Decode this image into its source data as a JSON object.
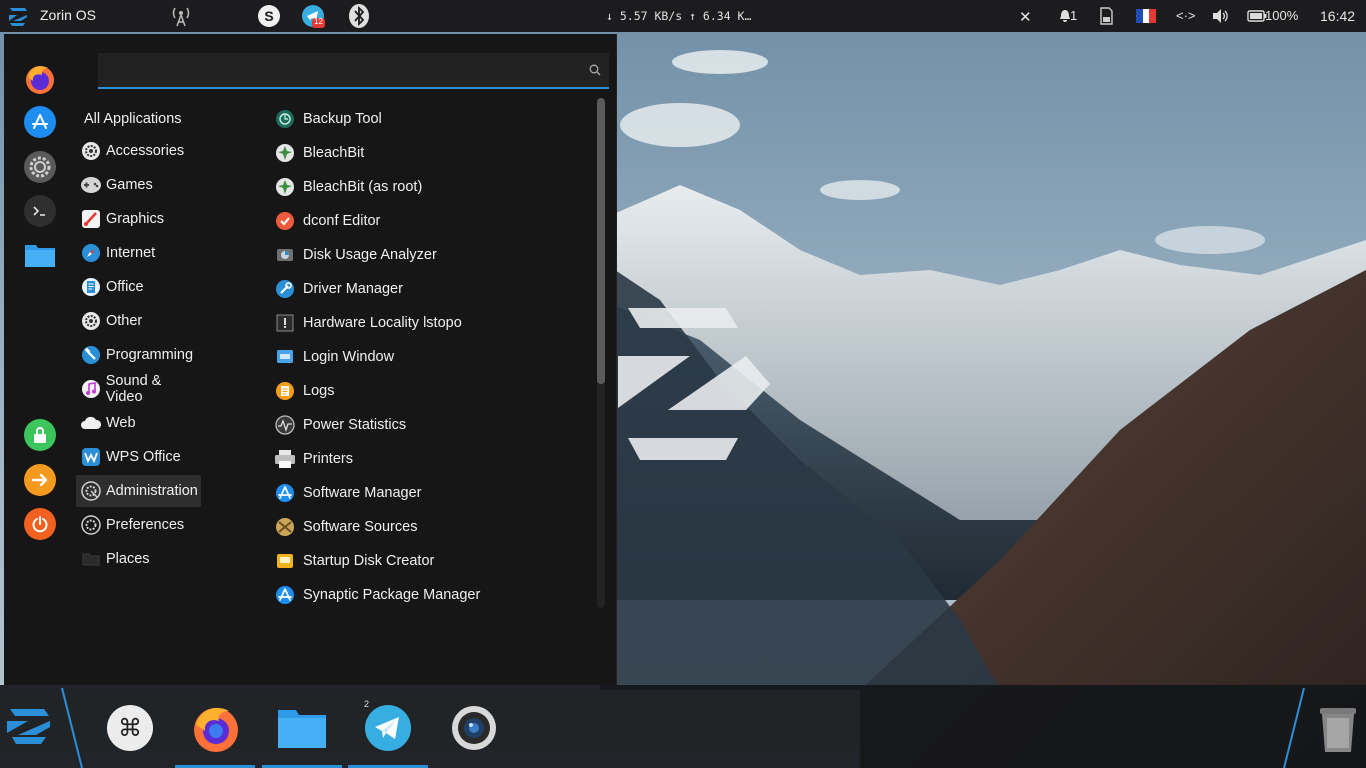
{
  "top_panel": {
    "title": "Zorin OS",
    "network_speed": "↓ 5.57 KB/s ↑ 6.34 K…",
    "notification_count": "1",
    "battery": "100%",
    "clock": "16:42",
    "telegram_badge": "12"
  },
  "search": {
    "placeholder": "",
    "value": ""
  },
  "categories": [
    {
      "label": "All Applications",
      "icon": "none"
    },
    {
      "label": "Accessories",
      "icon": "gear-icon"
    },
    {
      "label": "Games",
      "icon": "gamepad-icon"
    },
    {
      "label": "Graphics",
      "icon": "brush-icon"
    },
    {
      "label": "Internet",
      "icon": "compass-icon"
    },
    {
      "label": "Office",
      "icon": "document-icon"
    },
    {
      "label": "Other",
      "icon": "gear-icon"
    },
    {
      "label": "Programming",
      "icon": "hammer-icon"
    },
    {
      "label": "Sound & Video",
      "icon": "music-icon"
    },
    {
      "label": "Web",
      "icon": "cloud-icon"
    },
    {
      "label": "WPS Office",
      "icon": "wps-icon"
    },
    {
      "label": "Administration",
      "icon": "admin-icon"
    },
    {
      "label": "Preferences",
      "icon": "preferences-icon"
    },
    {
      "label": "Places",
      "icon": "folder-icon"
    }
  ],
  "selected_category": "Administration",
  "applications": [
    {
      "label": "Backup Tool",
      "icon": "backup-icon"
    },
    {
      "label": "BleachBit",
      "icon": "bleachbit-icon"
    },
    {
      "label": "BleachBit (as root)",
      "icon": "bleachbit-icon"
    },
    {
      "label": "dconf Editor",
      "icon": "dconf-icon"
    },
    {
      "label": "Disk Usage Analyzer",
      "icon": "disk-usage-icon"
    },
    {
      "label": "Driver Manager",
      "icon": "driver-icon"
    },
    {
      "label": "Hardware Locality lstopo",
      "icon": "hwloc-icon"
    },
    {
      "label": "Login Window",
      "icon": "login-icon"
    },
    {
      "label": "Logs",
      "icon": "logs-icon"
    },
    {
      "label": "Power Statistics",
      "icon": "power-stats-icon"
    },
    {
      "label": "Printers",
      "icon": "printer-icon"
    },
    {
      "label": "Software Manager",
      "icon": "software-manager-icon"
    },
    {
      "label": "Software Sources",
      "icon": "software-sources-icon"
    },
    {
      "label": "Startup Disk Creator",
      "icon": "startup-disk-icon"
    },
    {
      "label": "Synaptic Package Manager",
      "icon": "synaptic-icon"
    }
  ],
  "dock": {
    "telegram_badge": "2"
  },
  "colors": {
    "accent": "#2b8fd8",
    "menu_bg": "#161616",
    "panel_bg": "#1c1c1e"
  }
}
